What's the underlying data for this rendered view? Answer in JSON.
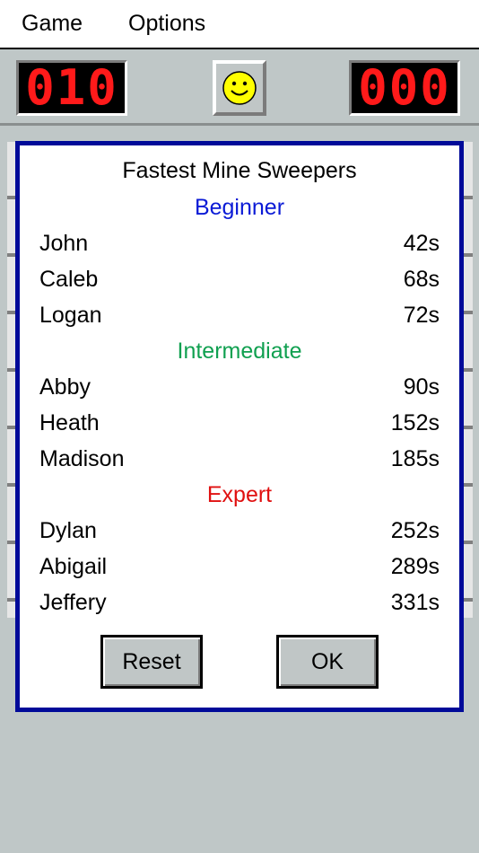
{
  "menu": {
    "game": "Game",
    "options": "Options"
  },
  "counters": {
    "mines": "010",
    "timer": "000"
  },
  "dialog": {
    "title": "Fastest Mine Sweepers",
    "sections": [
      {
        "label": "Beginner",
        "color": "#0a1ad6",
        "entries": [
          {
            "name": "John",
            "time": "42s"
          },
          {
            "name": "Caleb",
            "time": "68s"
          },
          {
            "name": "Logan",
            "time": "72s"
          }
        ]
      },
      {
        "label": "Intermediate",
        "color": "#10a050",
        "entries": [
          {
            "name": "Abby",
            "time": "90s"
          },
          {
            "name": "Heath",
            "time": "152s"
          },
          {
            "name": "Madison",
            "time": "185s"
          }
        ]
      },
      {
        "label": "Expert",
        "color": "#e01010",
        "entries": [
          {
            "name": "Dylan",
            "time": "252s"
          },
          {
            "name": "Abigail",
            "time": "289s"
          },
          {
            "name": "Jeffery",
            "time": "331s"
          }
        ]
      }
    ],
    "buttons": {
      "reset": "Reset",
      "ok": "OK"
    }
  },
  "icons": {
    "smiley": "smiley-face-icon"
  }
}
